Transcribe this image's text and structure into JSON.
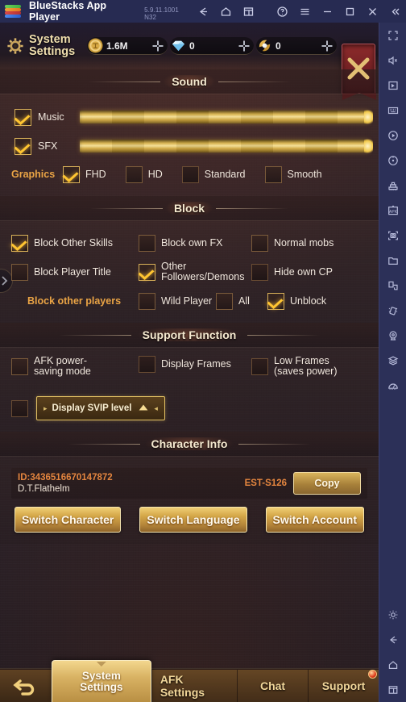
{
  "window": {
    "app_title": "BlueStacks App Player",
    "version": "5.9.11.1001  N32",
    "titlebar_icons": [
      "back-arrow-icon",
      "home-icon",
      "multi-window-icon",
      "help-circle-icon",
      "hamburger-menu-icon",
      "minimize-icon",
      "maximize-icon",
      "close-icon",
      "collapse-sidebar-icon"
    ]
  },
  "sidebar": {
    "icons": [
      "fullscreen-icon",
      "mute-speaker-icon",
      "pointer-cursor-icon",
      "keyboard-controls-icon",
      "macro-record-icon",
      "rotate-screen-icon",
      "multi-instance-icon",
      "install-apk-icon",
      "screenshot-icon",
      "media-folder-icon",
      "scripting-icon",
      "shake-icon",
      "location-icon",
      "layers-icon",
      "performance-gauge-icon",
      "settings-gear-icon",
      "android-back-icon",
      "android-home-icon",
      "android-recents-icon"
    ]
  },
  "game_header": {
    "title": "System Settings",
    "gear_icon": "settings-gear-icon",
    "close_icon": "close-x-banner-icon",
    "currencies": [
      {
        "icon": "gold-coin-icon",
        "value": "1.6M",
        "add_icon": "add-plus-icon"
      },
      {
        "icon": "diamond-icon",
        "value": "0",
        "add_icon": "add-plus-icon"
      },
      {
        "icon": "gold-wing-emblem-icon",
        "value": "0",
        "add_icon": "add-plus-icon"
      }
    ]
  },
  "edge_tab": {
    "icon": "chevron-right-icon"
  },
  "sections": {
    "sound": {
      "title": "Sound",
      "sliders": [
        {
          "label": "Music",
          "checked": true,
          "value": 100
        },
        {
          "label": "SFX",
          "checked": true,
          "value": 100
        }
      ],
      "graphics_label": "Graphics",
      "graphics_options": [
        {
          "label": "FHD",
          "checked": true
        },
        {
          "label": "HD",
          "checked": false
        },
        {
          "label": "Standard",
          "checked": false
        },
        {
          "label": "Smooth",
          "checked": false
        }
      ]
    },
    "block": {
      "title": "Block",
      "rows": [
        [
          {
            "label": "Block Other Skills",
            "checked": true
          },
          {
            "label": "Block own FX",
            "checked": false
          },
          {
            "label": "Normal mobs",
            "checked": false
          }
        ],
        [
          {
            "label": "Block Player Title",
            "checked": false
          },
          {
            "label": "Other Followers/Demons",
            "checked": true
          },
          {
            "label": "Hide own CP",
            "checked": false
          }
        ]
      ],
      "block_other_players_label": "Block other players",
      "block_other_players_options": [
        {
          "label": "Wild Player",
          "checked": false
        },
        {
          "label": "All",
          "checked": false
        },
        {
          "label": "Unblock",
          "checked": true
        }
      ]
    },
    "support_function": {
      "title": "Support Function",
      "row1": [
        {
          "label": "AFK power-saving mode",
          "checked": false
        },
        {
          "label": "Display Frames",
          "checked": false
        },
        {
          "label": "Low Frames (saves power)",
          "checked": false
        }
      ],
      "svip_checkbox_checked": false,
      "svip_button_label": "Display SVIP level",
      "svip_button_arrow_icon": "chevron-up-icon"
    },
    "character_info": {
      "title": "Character Info",
      "id": "ID:3436516670147872",
      "name": "D.T.Flathelm",
      "server": "EST-S126",
      "copy_label": "Copy",
      "buttons": [
        "Switch Character",
        "Switch Language",
        "Switch Account"
      ]
    }
  },
  "tabbar": {
    "back_icon": "back-undo-arrow-icon",
    "tabs": [
      {
        "label": "System Settings",
        "active": true,
        "badge": false
      },
      {
        "label": "AFK Settings",
        "active": false,
        "badge": false
      },
      {
        "label": "Chat",
        "active": false,
        "badge": false
      },
      {
        "label": "Support",
        "active": false,
        "badge": true
      }
    ]
  },
  "colors": {
    "gold": "#d8b058",
    "gold_text": "#f2d79a",
    "orange_label": "#eaa445",
    "check_yellow": "#ffc531",
    "red_close": "#8e2b2c",
    "bluestacks_chrome": "#272b52"
  }
}
